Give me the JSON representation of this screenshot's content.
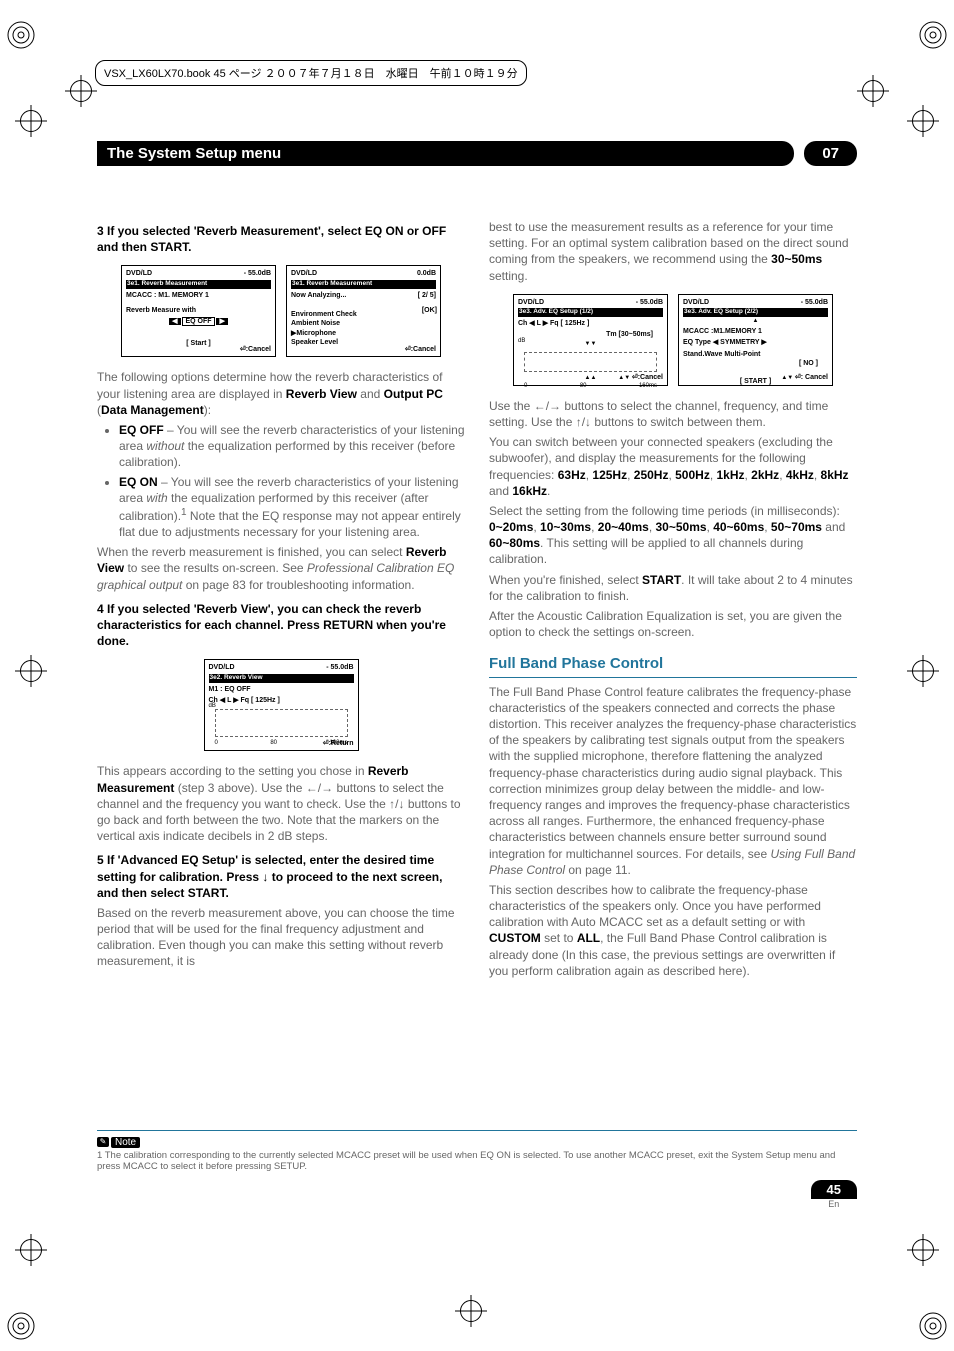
{
  "book_header": "VSX_LX60LX70.book  45 ページ  ２００７年７月１８日　水曜日　午前１０時１９分",
  "title_bar": {
    "title": "The System Setup menu",
    "chapter": "07"
  },
  "left": {
    "step3": "3   If you selected 'Reverb Measurement', select EQ ON or OFF and then START.",
    "screenA": {
      "dl": "DVD/LD",
      "db": "- 55.0dB",
      "bar": "3e1. Reverb Measurement",
      "mcacc": "MCACC   : M1. MEMORY 1",
      "reverb_line": "Reverb Measure with",
      "eq": "EQ OFF",
      "start": "[ Start ]",
      "cancel": ":Cancel"
    },
    "screenB": {
      "dl": "DVD/LD",
      "db": "0.0dB",
      "bar": "3e1. Reverb Measurement",
      "now": "Now Analyzing...",
      "prog": "[ 2/ 5]",
      "env": "Environment Check",
      "amb": " Ambient Noise",
      "mic": "▶Microphone",
      "spk": " Speaker Level",
      "ok": "[OK]",
      "cancel": ":Cancel"
    },
    "p1": "The following options determine how the reverb characteristics of your listening area are displayed in ",
    "p1b": "Reverb View",
    "p1c": " and ",
    "p1d": "Output PC",
    "p1e": " (",
    "p1f": "Data Management",
    "p1g": "):",
    "li1a": "EQ OFF",
    "li1b": " – You will see the reverb characteristics of your listening area ",
    "li1c": "without",
    "li1d": " the equalization performed by this receiver (before calibration).",
    "li2a": "EQ ON",
    "li2b": " – You will see the reverb characteristics of your listening area ",
    "li2c": "with",
    "li2d": " the equalization performed by this receiver (after calibration).",
    "li2e": " Note that the EQ response may not appear entirely flat due to adjustments necessary for your listening area.",
    "p2a": "When the reverb measurement is finished, you can select ",
    "p2b": "Reverb View",
    "p2c": " to see the results on-screen. See ",
    "p2d": "Professional Calibration EQ graphical output",
    "p2e": " on page 83 for troubleshooting information.",
    "step4": "4   If you selected 'Reverb View', you can check the reverb characteristics for each channel. Press RETURN when you're done.",
    "screenC": {
      "dl": "DVD/LD",
      "db": "- 55.0dB",
      "bar": "3e2. Reverb View",
      "m1": "M1 : EQ OFF",
      "ch": "Ch ◀  L  ▶ Fq  [   125Hz ]",
      "dblabel": "dB",
      "x0": "0",
      "x80": "80",
      "x160": "160ms",
      "ret": ":Return"
    },
    "p3a": "This appears according to the setting you chose in ",
    "p3b": "Reverb Measurement",
    "p3c": " (step 3 above). Use the ←/→ buttons to select the channel and the frequency you want to check. Use the ↑/↓ buttons to go back and forth between the two. Note that the markers on the vertical axis indicate decibels in 2 dB steps.",
    "step5": "5   If 'Advanced EQ Setup' is selected, enter the desired time setting for calibration. Press ↓ to proceed to the next screen, and then select START.",
    "p4": "Based on the reverb measurement above, you can choose the time period that will be used for the final frequency adjustment and calibration. Even though you can make this setting without reverb measurement, it is"
  },
  "right": {
    "p1a": "best to use the measurement results as a reference for your time setting. For an optimal system calibration based on the direct sound coming from the speakers, we recommend using the ",
    "p1b": "30~50ms",
    "p1c": " setting.",
    "screenD": {
      "dl": "DVD/LD",
      "db": "- 55.0dB",
      "bar": "3e3. Adv. EQ Setup (1/2)",
      "ch": "Ch ◀  L  ▶ Fq   [   125Hz ]",
      "tm": "Tm    [30~50ms]",
      "yy": "▼▼",
      "xx": "▲▲",
      "dblabel": "dB",
      "x0": "0",
      "x80": "80",
      "x160": "160ms",
      "cancel": ":Cancel"
    },
    "screenE": {
      "dl": "DVD/LD",
      "db": "- 55.0dB",
      "bar": "3e3. Adv. EQ Setup (2/2)",
      "mcacc": "MCACC   :M1.MEMORY 1",
      "eqtype": "EQ Type  ◀ SYMMETRY ▶",
      "stand": "Stand.Wave Multi-Point",
      "no": "[ NO ]",
      "start": "[ START ]",
      "cancel": ": Cancel"
    },
    "p2": "Use the ←/→ buttons to select the channel, frequency, and time setting. Use the ↑/↓ buttons to switch between them.",
    "p3a": "You can switch between your connected speakers (excluding the subwoofer), and display the measurements for the following frequencies: ",
    "p3b": "63Hz",
    "p3c": "125Hz",
    "p3d": "250Hz",
    "p3e": "500Hz",
    "p3f": "1kHz",
    "p3g": "2kHz",
    "p3h": "4kHz",
    "p3i": "8kHz",
    "p3j": "16kHz",
    "p4a": "Select the setting from the following time periods (in milliseconds): ",
    "p4b": "0~20ms",
    "p4c": "10~30ms",
    "p4d": "20~40ms",
    "p4e": "30~50ms",
    "p4f": "40~60ms",
    "p4g": "50~70ms",
    "p4h": "60~80ms",
    "p4i": ". This setting will be applied to all channels during calibration.",
    "p5a": "When you're finished, select ",
    "p5b": "START",
    "p5c": ". It will take about 2 to 4 minutes for the calibration to finish.",
    "p6": "After the Acoustic Calibration Equalization is set, you are given the option to check the settings on-screen.",
    "section": "Full Band Phase Control",
    "p7a": "The Full Band Phase Control feature calibrates the frequency-phase characteristics of the speakers connected and corrects the phase distortion. This receiver analyzes the frequency-phase characteristics of the speakers by calibrating test signals output from the speakers with the supplied microphone, therefore flattening the analyzed frequency-phase characteristics during audio signal playback. This correction minimizes group delay between the middle- and low-frequency ranges and improves the frequency-phase characteristics across all ranges. Furthermore, the enhanced frequency-phase characteristics between channels ensure better surround sound integration for multichannel sources. For details, see ",
    "p7b": "Using Full Band Phase Control",
    "p7c": " on page 11.",
    "p8a": "This section describes how to calibrate the frequency-phase characteristics of the speakers only. Once you have performed calibration with Auto MCACC set as a default setting or with ",
    "p8b": "CUSTOM",
    "p8c": " set to ",
    "p8d": "ALL",
    "p8e": ", the Full Band Phase Control calibration is already done (In this case, the previous settings are overwritten if you perform calibration again as described here)."
  },
  "footnote": {
    "label": "Note",
    "text": "1 The calibration corresponding to the currently selected MCACC preset will be used when EQ ON is selected. To use another MCACC preset, exit the System Setup menu and press MCACC to select it before pressing SETUP."
  },
  "page": {
    "num": "45",
    "lang": "En"
  }
}
